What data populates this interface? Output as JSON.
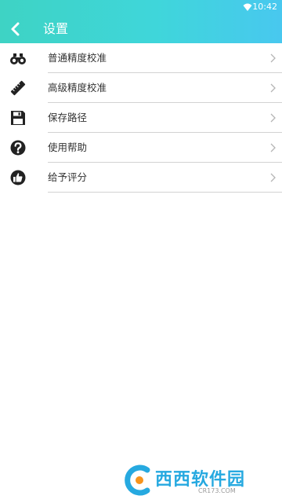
{
  "status_bar": {
    "time": "10:42",
    "wifi_icon": "wifi-icon"
  },
  "header": {
    "title": "设置",
    "back_icon": "back-arrow-icon",
    "gradient_colors": [
      "#3ed3c4",
      "#48c8ef"
    ]
  },
  "items": [
    {
      "label": "普通精度校准",
      "icon": "binoculars-icon"
    },
    {
      "label": "高级精度校准",
      "icon": "ruler-icon"
    },
    {
      "label": "保存路径",
      "icon": "save-icon"
    },
    {
      "label": "使用帮助",
      "icon": "help-icon"
    },
    {
      "label": "给予评分",
      "icon": "thumbs-up-icon"
    }
  ],
  "watermark": {
    "text": "西西软件园",
    "sub": "CR173.COM"
  }
}
